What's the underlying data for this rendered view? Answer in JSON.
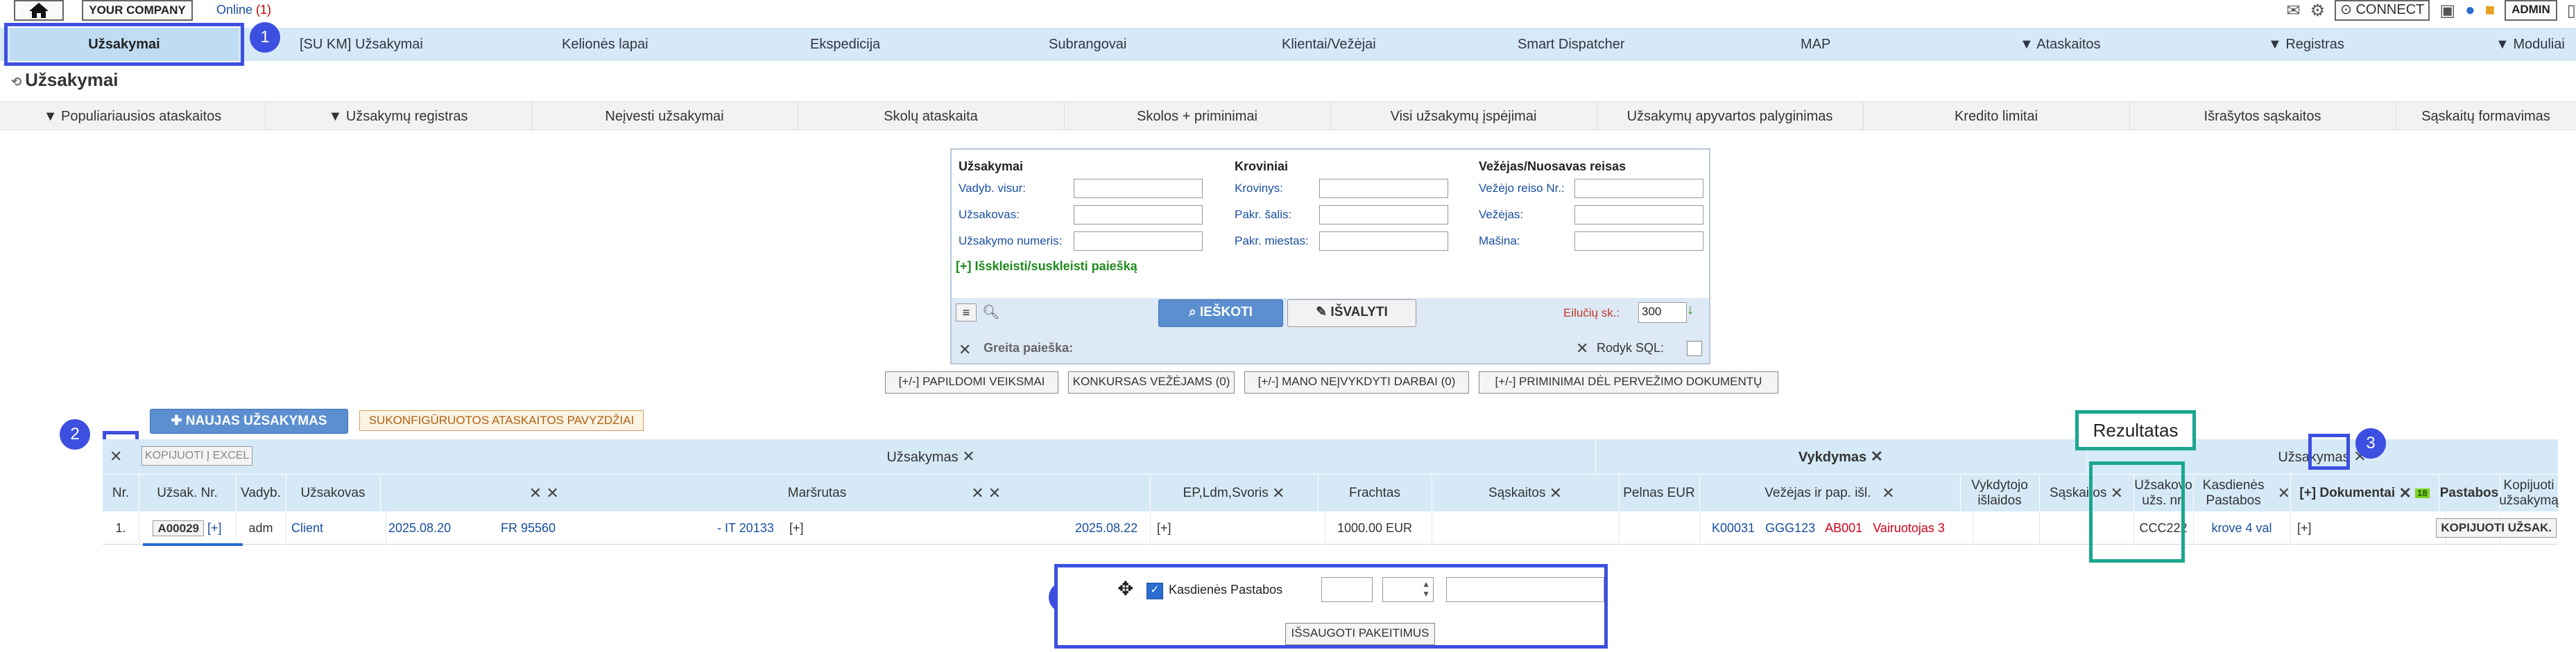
{
  "topbar": {
    "company": "YOUR COMPANY",
    "online_label": "Online",
    "online_count": "(1)",
    "connect": "CONNECT",
    "admin": "ADMIN"
  },
  "mainnav": [
    "Užsakymai",
    "[SU KM] Užsakymai",
    "Kelionės lapai",
    "Ekspedicija",
    "Subrangovai",
    "Klientai/Vežėjai",
    "Smart Dispatcher",
    "MAP",
    "▼ Ataskaitos",
    "▼ Registras",
    "▼ Moduliai"
  ],
  "page_title": "Užsakymai",
  "subnav": [
    "▼ Populiariausios ataskaitos",
    "▼ Užsakymų registras",
    "Neįvesti užsakymai",
    "Skolų ataskaita",
    "Skolos + priminimai",
    "Visi užsakymų įspėjimai",
    "Užsakymų apyvartos palyginimas",
    "Kredito limitai",
    "Išrašytos sąskaitos",
    "Sąskaitų formavimas"
  ],
  "search": {
    "col1_title": "Užsakymai",
    "col1_labels": [
      "Vadyb. visur:",
      "Užsakovas:",
      "Užsakymo numeris:"
    ],
    "col2_title": "Kroviniai",
    "col2_labels": [
      "Krovinys:",
      "Pakr. šalis:",
      "Pakr. miestas:"
    ],
    "col3_title": "Vežėjas/Nuosavas reisas",
    "col3_labels": [
      "Vežėjo reiso Nr.:",
      "Vežėjas:",
      "Mašina:"
    ],
    "expand": "[+] Išskleisti/suskleisti paiešką",
    "search_btn": "IEŠKOTI",
    "clear_btn": "IŠVALYTI",
    "per_page_label": "Eilučių sk.:",
    "per_page_value": "300",
    "quick_search": "Greita paieška:",
    "show_sql": "Rodyk SQL:"
  },
  "actions": [
    "[+/-] PAPILDOMI VEIKSMAI",
    "KONKURSAS VEŽĖJAMS (0)",
    "[+/-] MANO NEĮVYKDYTI DARBAI (0)",
    "[+/-] PRIMINIMAI DĖL PERVEŽIMO DOKUMENTŲ"
  ],
  "new_order": "NAUJAS UŽSAKYMAS",
  "report_examples": "SUKONFIGŪRUOTOS ATASKAITOS PAVYZDŽIAI",
  "copy_excel": "KOPIJUOTI Į EXCEL",
  "table": {
    "groups": [
      "Užsakymas",
      "Vykdymas",
      "Užsakymas"
    ],
    "headers": [
      "Nr.",
      "Užsak. Nr.",
      "Vadyb.",
      "Užsakovas",
      "Maršrutas",
      "EP,Ldm,Svoris",
      "Frachtas",
      "Sąskaitos",
      "Pelnas EUR",
      "Vežėjas ir pap. išl.",
      "Vykdytojo išlaidos",
      "Sąskaitos",
      "Užsakovo užs. nr.",
      "Kasdienės Pastabos",
      "[+] Dokumentai",
      "Pastabos",
      "Kopijuoti užsakymą"
    ],
    "docs_badge": "18",
    "row": {
      "nr": "1.",
      "order_no": "A00029",
      "order_plus": "[+]",
      "manager": "adm",
      "client": "Client",
      "date1": "2025.08.20",
      "from": "FR 95560",
      "to": "- IT 20133",
      "route_plus": "[+]",
      "date2": "2025.08.22",
      "ep_plus": "[+]",
      "freight": "1000.00 EUR",
      "carrier_code": "K00031",
      "truck": "GGG123",
      "trailer": "AB001",
      "driver": "Vairuotojas 3",
      "client_order_no": "CCC222",
      "daily_notes": "krove 4 val",
      "docs_plus": "[+]",
      "copy_btn": "KOPIJUOTI UŽSAK."
    }
  },
  "bottom": {
    "checkbox_label": "Kasdienės Pastabos",
    "save_btn": "IŠSAUGOTI PAKEITIMUS"
  },
  "callout": "Rezultatas",
  "markers": [
    "1",
    "2",
    "3",
    "4"
  ]
}
